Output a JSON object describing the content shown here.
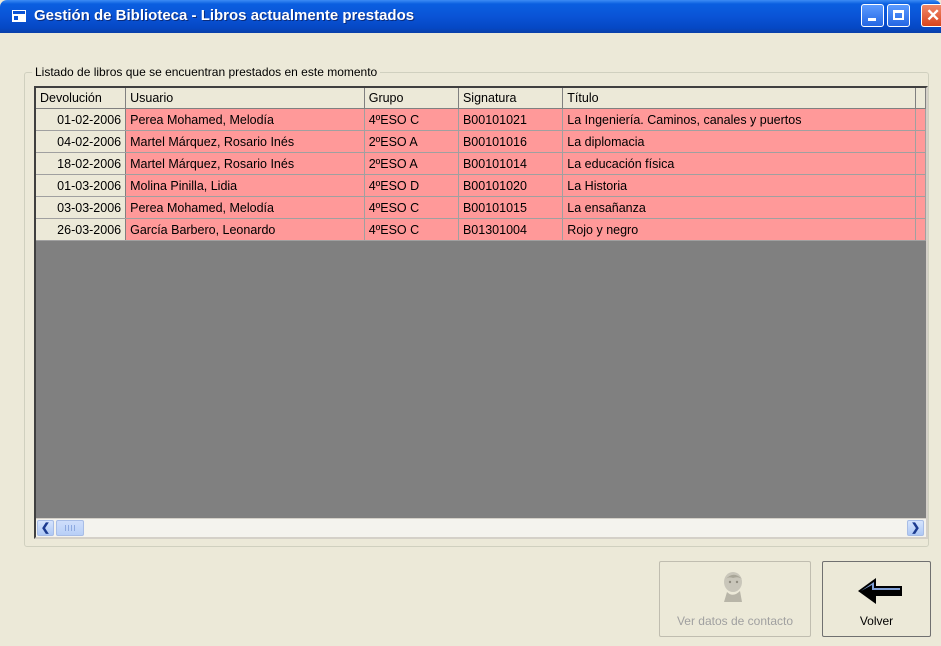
{
  "window": {
    "title": "Gestión de Biblioteca - Libros actualmente prestados",
    "title_icon": "window-app-icon",
    "controls": [
      "minimize-icon",
      "maximize-icon",
      "close-icon"
    ]
  },
  "groupbox": {
    "label": "Listado de libros que se encuentran prestados en este momento"
  },
  "grid": {
    "columns": [
      "Devolución",
      "Usuario",
      "Grupo",
      "Signatura",
      "Título"
    ],
    "rows": [
      [
        "01-02-2006",
        "Perea Mohamed, Melodía",
        "4ºESO C",
        "B00101021",
        "La Ingeniería. Caminos, canales y puertos"
      ],
      [
        "04-02-2006",
        "Martel Márquez, Rosario Inés",
        "2ºESO A",
        "B00101016",
        "La diplomacia"
      ],
      [
        "18-02-2006",
        "Martel Márquez, Rosario Inés",
        "2ºESO A",
        "B00101014",
        "La educación física"
      ],
      [
        "01-03-2006",
        "Molina Pinilla, Lidia",
        "4ºESO D",
        "B00101020",
        "La Historia"
      ],
      [
        "03-03-2006",
        "Perea Mohamed, Melodía",
        "4ºESO C",
        "B00101015",
        "La ensañanza"
      ],
      [
        "26-03-2006",
        "García Barbero, Leonardo",
        "4ºESO C",
        "B01301004",
        "Rojo y negro"
      ]
    ],
    "row_color": "#ff9999"
  },
  "buttons": {
    "contact_label": "Ver datos de contacto",
    "back_label": "Volver"
  },
  "colors": {
    "titlebar": "#0a53d6",
    "window_bg": "#ece9d8",
    "grid_bg": "#808080"
  }
}
